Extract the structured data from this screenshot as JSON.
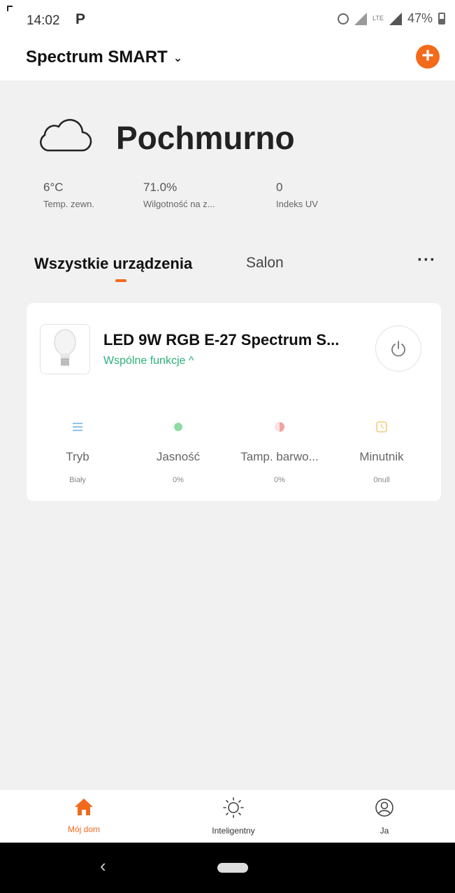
{
  "status_bar": {
    "time": "14:02",
    "notification": "P",
    "lte": "LTE",
    "battery": "47%"
  },
  "header": {
    "home_name": "Spectrum SMART",
    "add_label": "+"
  },
  "weather": {
    "condition": "Pochmurno",
    "stats": [
      {
        "value": "6°C",
        "label": "Temp. zewn."
      },
      {
        "value": "71.0%",
        "label": "Wilgotność na z..."
      },
      {
        "value": "0",
        "label": "Indeks UV"
      }
    ]
  },
  "tabs": {
    "items": [
      "Wszystkie urządzenia",
      "Salon"
    ],
    "active": "Wszystkie urządzenia",
    "more": "···"
  },
  "device": {
    "name": "LED 9W RGB E-27 Spectrum S...",
    "functions_label": "Wspólne funkcje ^",
    "controls": [
      {
        "name": "Tryb",
        "value": "Biały",
        "icon": "list-icon",
        "color": "#8ec5ea"
      },
      {
        "name": "Jasność",
        "value": "0%",
        "icon": "brightness-icon",
        "color": "#8fdca4"
      },
      {
        "name": "Tamp. barwo...",
        "value": "0%",
        "icon": "color-temp-icon",
        "color": "#f2a3a3"
      },
      {
        "name": "Minutnik",
        "value": "0null",
        "icon": "timer-icon",
        "color": "#f3d38a"
      }
    ]
  },
  "bottom_nav": {
    "items": [
      {
        "label": "Mój dom",
        "icon": "home-icon",
        "active": true
      },
      {
        "label": "Inteligentny",
        "icon": "sun-icon",
        "active": false
      },
      {
        "label": "Ja",
        "icon": "profile-icon",
        "active": false
      }
    ]
  },
  "colors": {
    "accent": "#f26a1b",
    "link_green": "#2db07b",
    "background": "#f1f1f1"
  }
}
